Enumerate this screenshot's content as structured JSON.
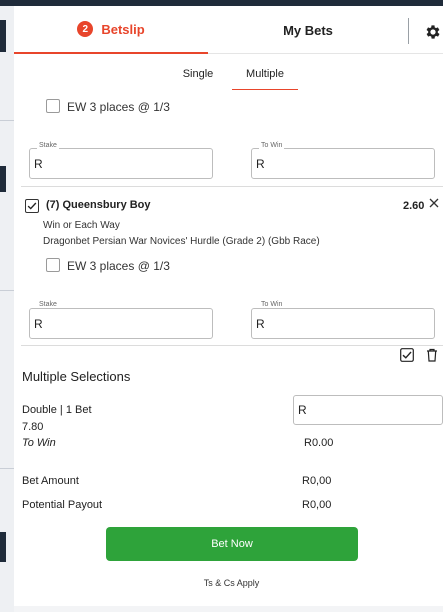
{
  "header": {
    "betslip_count": "2",
    "betslip_label": "Betslip",
    "mybets_label": "My Bets"
  },
  "subtabs": {
    "single": "Single",
    "multiple": "Multiple"
  },
  "selection1": {
    "ew_label": "EW 3 places @ 1/3",
    "stake_label": "Stake",
    "stake_value": "R",
    "towin_label": "To Win",
    "towin_value": "R"
  },
  "selection2": {
    "title": "(7) Queensbury Boy",
    "odds": "2.60",
    "bet_type": "Win or Each Way",
    "event": "Dragonbet Persian War Novices' Hurdle (Grade 2) (Gbb Race)",
    "ew_label": "EW 3 places @ 1/3",
    "stake_label": "Stake",
    "stake_value": "R",
    "towin_label": "To Win",
    "towin_value": "R"
  },
  "multiples": {
    "title": "Multiple Selections",
    "double_label": "Double | 1 Bet",
    "double_odds": "7.80",
    "double_stake": "R",
    "towin_label": "To Win",
    "towin_value": "R0.00"
  },
  "summary": {
    "bet_amount_label": "Bet Amount",
    "bet_amount_value": "R0,00",
    "potential_payout_label": "Potential Payout",
    "potential_payout_value": "R0,00"
  },
  "actions": {
    "bet_now": "Bet Now",
    "terms": "Ts & Cs Apply"
  },
  "colors": {
    "accent": "#e8452b",
    "bet_button": "#2ea33a"
  },
  "icons": [
    "settings-gear-icon",
    "close-icon",
    "checkbox-check-icon",
    "trash-icon"
  ]
}
